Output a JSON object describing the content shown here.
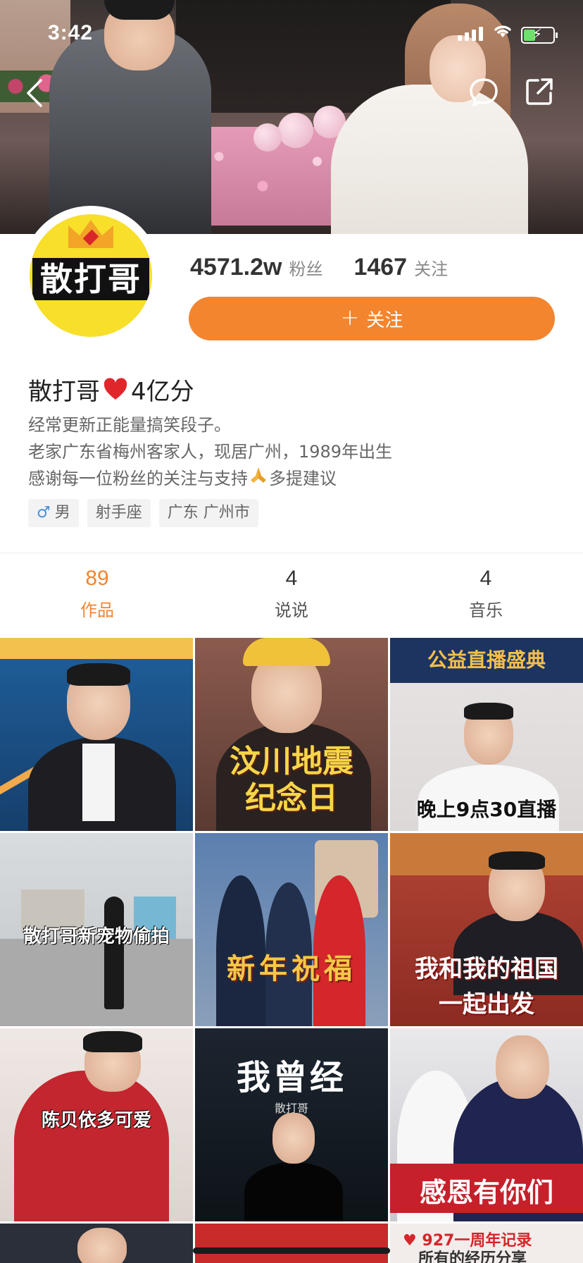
{
  "status_bar": {
    "time": "3:42"
  },
  "profile": {
    "avatar_text": "散打哥",
    "fans_count": "4571.2w",
    "fans_label": "粉丝",
    "following_count": "1467",
    "following_label": "关注",
    "follow_button": "关注",
    "nickname_prefix": "散打哥",
    "nickname_suffix": "4亿分",
    "bio_lines": [
      "经常更新正能量搞笑段子。",
      "老家广东省梅州客家人，现居广州，1989年出生",
      "感谢每一位粉丝的关注与支持",
      "多提建议"
    ],
    "tags": {
      "gender": "男",
      "zodiac": "射手座",
      "location": "广东 广州市"
    }
  },
  "tabs": [
    {
      "count": "89",
      "label": "作品",
      "active": true
    },
    {
      "count": "4",
      "label": "说说",
      "active": false
    },
    {
      "count": "4",
      "label": "音乐",
      "active": false
    }
  ],
  "videos": [
    {
      "caption": ""
    },
    {
      "caption_line1": "汶川地震",
      "caption_line2": "纪念日"
    },
    {
      "top": "公益直播盛典",
      "caption": "晚上9点30直播"
    },
    {
      "caption": "散打哥新宠物偷拍"
    },
    {
      "caption": "新年祝福"
    },
    {
      "caption_line1": "我和我的祖国",
      "caption_line2": "一起出发"
    },
    {
      "caption": "陈贝依多可爱"
    },
    {
      "caption": "我曾经",
      "sub": "散打哥"
    },
    {
      "caption": "感恩有你们"
    }
  ],
  "bottom_row": {
    "right_line1": "927一周年记录",
    "right_line2": "所有的经历分享"
  },
  "colors": {
    "accent": "#f3852f",
    "tag_bg": "#f3f3f3"
  },
  "icons": [
    "back-icon",
    "message-icon",
    "share-icon",
    "heart-icon",
    "pray-icon",
    "male-icon",
    "plus-icon"
  ]
}
